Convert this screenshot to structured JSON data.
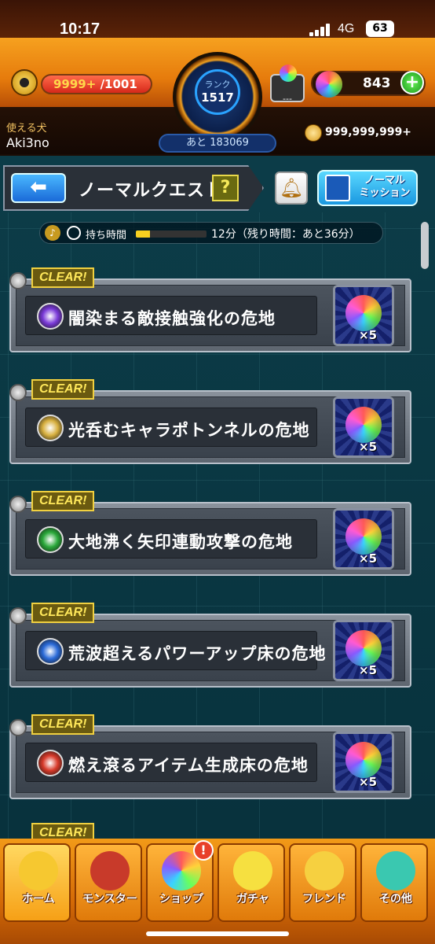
{
  "status_bar": {
    "time": "10:17",
    "network": "4G",
    "battery": "63"
  },
  "header": {
    "stamina": {
      "current": "9999+",
      "max": "/1001"
    },
    "rank": {
      "label": "ランク",
      "value": "1517",
      "next_prefix": "あと",
      "next_value": "183069"
    },
    "capacity": "---",
    "orbs": "843",
    "user_label": "使える犬",
    "user_name": "Aki3no",
    "coins": "999,999,999+"
  },
  "titlebar": {
    "title": "ノーマルクエスト",
    "help": "?",
    "mission_line1": "ノーマル",
    "mission_line2": "ミッション"
  },
  "timer": {
    "label": "持ち時間",
    "text": "12分（残り時間：あと36分）",
    "progress": 0.2
  },
  "quests": [
    {
      "clear": "CLEAR!",
      "name": "闇染まる敵接触強化の危地",
      "reward": "×5",
      "element_color": "#7a3ad8",
      "element_icon": "dark-element-icon"
    },
    {
      "clear": "CLEAR!",
      "name": "光呑むキャラポトンネルの危地",
      "reward": "×5",
      "element_color": "#d8b040",
      "element_icon": "light-element-icon"
    },
    {
      "clear": "CLEAR!",
      "name": "大地沸く矢印連動攻撃の危地",
      "reward": "×5",
      "element_color": "#2aa83a",
      "element_icon": "wood-element-icon"
    },
    {
      "clear": "CLEAR!",
      "name": "荒波超えるパワーアップ床の危地",
      "reward": "×5",
      "element_color": "#2a6ad8",
      "element_icon": "water-element-icon"
    },
    {
      "clear": "CLEAR!",
      "name": "燃え滾るアイテム生成床の危地",
      "reward": "×5",
      "element_color": "#d83a2a",
      "element_icon": "fire-element-icon"
    }
  ],
  "quest6_clear": "CLEAR!",
  "nav": [
    {
      "label": "ホーム",
      "icon": "home-icon"
    },
    {
      "label": "モンスター",
      "icon": "monster-icon"
    },
    {
      "label": "ショップ",
      "icon": "shop-icon",
      "badge": "!"
    },
    {
      "label": "ガチャ",
      "icon": "gacha-icon"
    },
    {
      "label": "フレンド",
      "icon": "friend-icon"
    },
    {
      "label": "その他",
      "icon": "other-icon"
    }
  ]
}
